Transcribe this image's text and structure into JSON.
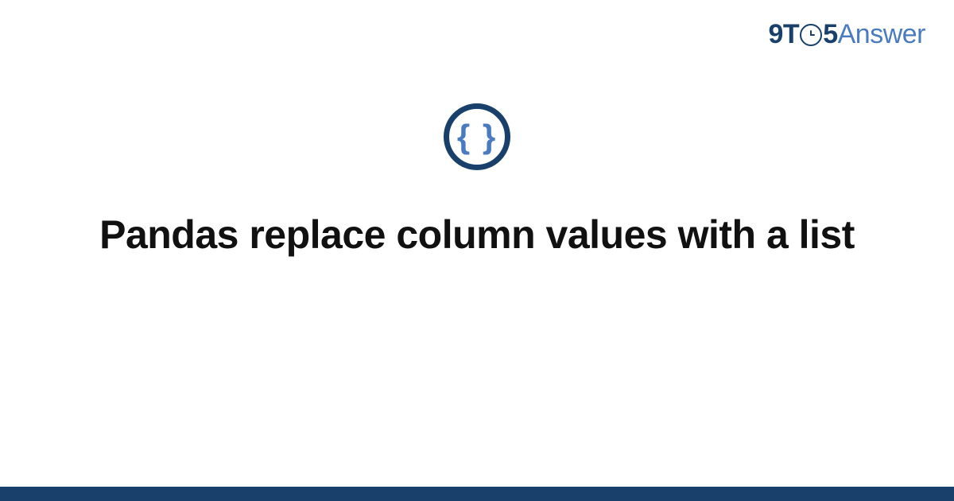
{
  "logo": {
    "part1": "9T",
    "part2": "5",
    "part3": "Answer"
  },
  "icon": {
    "braces": "{ }"
  },
  "title": "Pandas replace column values with a list"
}
